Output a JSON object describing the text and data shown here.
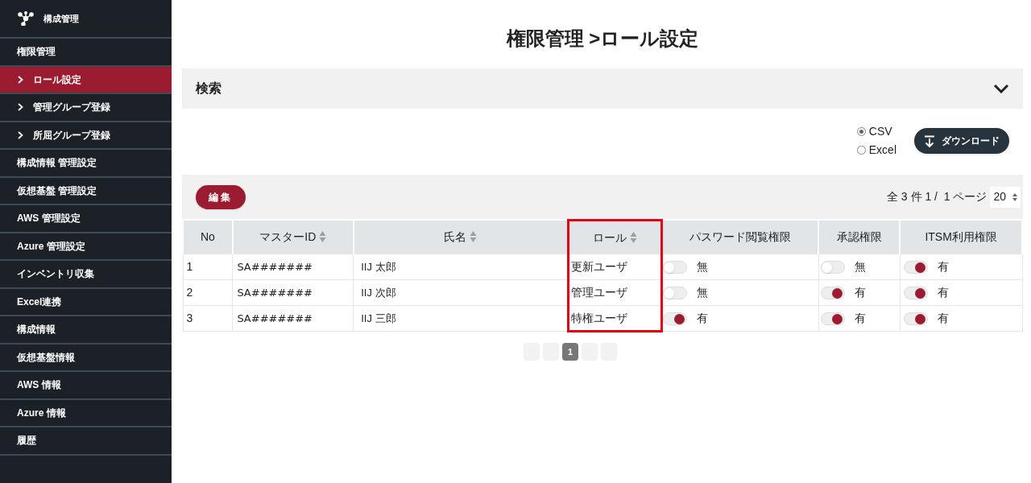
{
  "sidebar": {
    "logo": "構成管理",
    "items": [
      {
        "label": "権限管理",
        "kind": "section",
        "selected": false
      },
      {
        "label": "ロール設定",
        "kind": "sub",
        "selected": true
      },
      {
        "label": "管理グループ登録",
        "kind": "sub",
        "selected": false
      },
      {
        "label": "所屈グループ登録",
        "kind": "sub",
        "selected": false
      },
      {
        "label": "構成情報 管理設定",
        "kind": "section",
        "selected": false
      },
      {
        "label": "仮想基盤 管理設定",
        "kind": "section",
        "selected": false
      },
      {
        "label": "AWS 管理設定",
        "kind": "section",
        "selected": false
      },
      {
        "label": "Azure 管理設定",
        "kind": "section",
        "selected": false
      },
      {
        "label": "インベントリ収集",
        "kind": "section",
        "selected": false
      },
      {
        "label": "Excel連携",
        "kind": "section",
        "selected": false
      },
      {
        "label": "構成情報",
        "kind": "section",
        "selected": false
      },
      {
        "label": "仮想基盤情報",
        "kind": "section",
        "selected": false
      },
      {
        "label": "AWS 情報",
        "kind": "section",
        "selected": false
      },
      {
        "label": "Azure 情報",
        "kind": "section",
        "selected": false
      },
      {
        "label": "履歴",
        "kind": "section",
        "selected": false
      }
    ]
  },
  "page_title": "権限管理 >ロール設定",
  "search": {
    "title": "検索",
    "expanded": false
  },
  "export": {
    "formats": [
      {
        "label": "CSV",
        "selected": true
      },
      {
        "label": "Excel",
        "selected": false
      }
    ],
    "download_button": "ダウンロード"
  },
  "toolbar": {
    "edit_button": "編集",
    "summary": "全 3 件 1 /  1 ページ",
    "page_size": "20"
  },
  "table": {
    "columns": [
      {
        "label": "No",
        "sortable": false
      },
      {
        "label": "マスターID",
        "sortable": true
      },
      {
        "label": "氏名",
        "sortable": true
      },
      {
        "label": "ロール",
        "sortable": true,
        "highlighted": true
      },
      {
        "label": "パスワード閲覧権限",
        "sortable": false
      },
      {
        "label": "承認権限",
        "sortable": false
      },
      {
        "label": "ITSM利用権限",
        "sortable": false
      }
    ],
    "rows": [
      {
        "no": "1",
        "master_id": "SA#######",
        "name": "IIJ 太郎",
        "role": "更新ユーザ",
        "password_view": {
          "on": false,
          "label": "無"
        },
        "approval": {
          "on": false,
          "label": "無"
        },
        "itsm": {
          "on": true,
          "label": "有"
        }
      },
      {
        "no": "2",
        "master_id": "SA#######",
        "name": "IIJ 次郎",
        "role": "管理ユーザ",
        "password_view": {
          "on": false,
          "label": "無"
        },
        "approval": {
          "on": true,
          "label": "有"
        },
        "itsm": {
          "on": true,
          "label": "有"
        }
      },
      {
        "no": "3",
        "master_id": "SA#######",
        "name": "IIJ 三郎",
        "role": "特権ユーザ",
        "password_view": {
          "on": true,
          "label": "有"
        },
        "approval": {
          "on": true,
          "label": "有"
        },
        "itsm": {
          "on": true,
          "label": "有"
        }
      }
    ]
  },
  "pagination": {
    "pages": [
      {
        "label": "1",
        "selected": true
      }
    ]
  }
}
